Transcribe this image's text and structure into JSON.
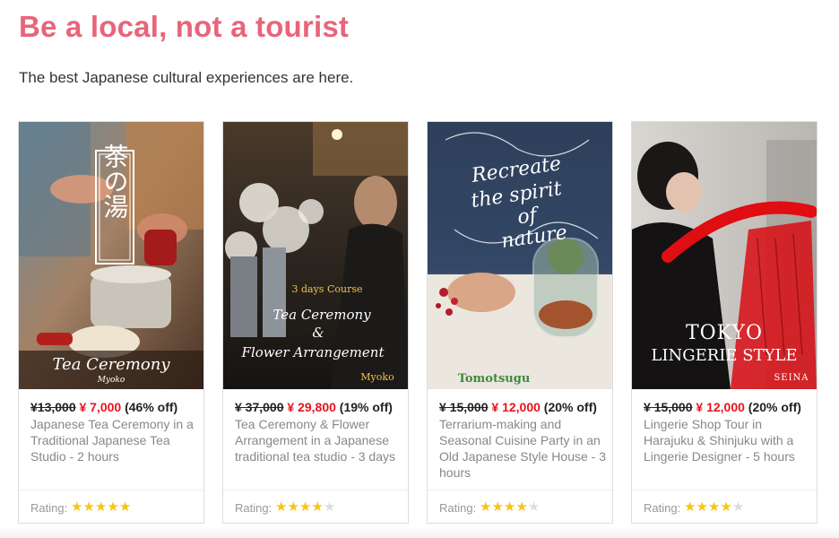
{
  "header": {
    "title": "Be a local, not a tourist",
    "subtitle": "The best Japanese cultural experiences are here."
  },
  "colors": {
    "accent": "#e9647a",
    "sale_price": "#e8141c",
    "star": "#f5c518",
    "star_empty": "#dddddd"
  },
  "cards": [
    {
      "image_kanji": "茶の湯",
      "image_caption": "Tea Ceremony",
      "image_host": "Myoko",
      "price_old": "¥13,000",
      "price_new": "¥ 7,000",
      "discount": "(46% off)",
      "description": "Japanese Tea Ceremony in a Traditional Japanese Tea Studio - 2 hours",
      "rating_label": "Rating:",
      "rating": 5
    },
    {
      "image_tag": "3 days Course",
      "image_caption_1": "Tea Ceremony",
      "image_caption_2": "&",
      "image_caption_3": "Flower Arrangement",
      "image_host": "Myoko",
      "price_old": "¥ 37,000",
      "price_new": "¥ 29,800",
      "discount": "(19% off)",
      "description": "Tea Ceremony & Flower Arrangement in a Japanese traditional tea studio - 3 days",
      "rating_label": "Rating:",
      "rating": 4
    },
    {
      "image_caption_1": "Recreate",
      "image_caption_2": "the spirit",
      "image_caption_3": "of",
      "image_caption_4": "nature",
      "image_host": "Tomotsugu",
      "price_old": "¥ 15,000",
      "price_new": "¥ 12,000",
      "discount": "(20% off)",
      "description": "Terrarium-making and Seasonal Cuisine Party in an Old Japanese Style House - 3 hours",
      "rating_label": "Rating:",
      "rating": 4
    },
    {
      "image_caption_1": "TOKYO",
      "image_caption_2": "LINGERIE STYLE",
      "image_host": "SEINA",
      "price_old": "¥ 15,000",
      "price_new": "¥ 12,000",
      "discount": "(20% off)",
      "description": "Lingerie Shop Tour in Harajuku & Shinjuku with a Lingerie Designer - 5 hours",
      "rating_label": "Rating:",
      "rating": 4
    }
  ]
}
